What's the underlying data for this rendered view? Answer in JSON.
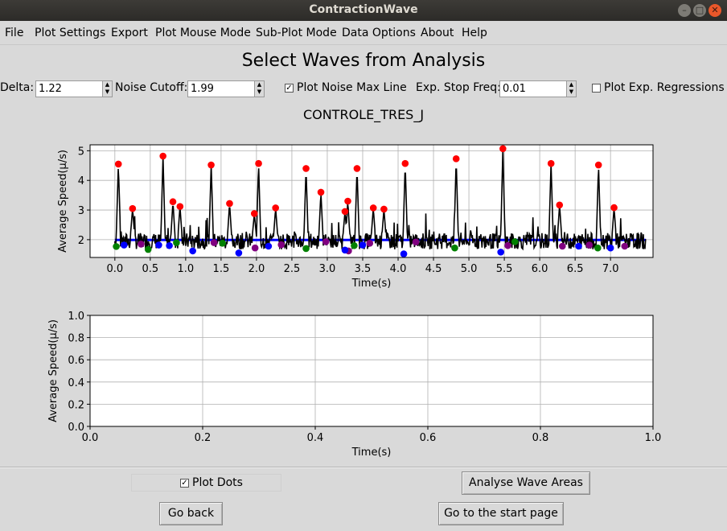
{
  "window": {
    "title": "ContractionWave"
  },
  "menu": [
    "File",
    "Plot Settings",
    "Export",
    "Plot Mouse Mode",
    "Sub-Plot Mode",
    "Data Options",
    "About",
    "Help"
  ],
  "heading": "Select Waves from Analysis",
  "controls": {
    "delta_label": "Delta:",
    "delta_value": "1.22",
    "noise_label": "Noise Cutoff:",
    "noise_value": "1.99",
    "plot_noise_label": "Plot Noise Max Line",
    "plot_noise_checked": true,
    "stop_label": "Exp. Stop Freq:",
    "stop_value": "0.01",
    "plot_exp_label": "Plot Exp. Regressions",
    "plot_exp_checked": false
  },
  "plot_title": "CONTROLE_TRES_J",
  "chart_data": [
    {
      "type": "line",
      "xlabel": "Time(s)",
      "ylabel": "Average Speed(μ/s)",
      "xlim": [
        -0.35,
        7.6
      ],
      "ylim": [
        1.4,
        5.2
      ],
      "xticks": [
        "0.0",
        "0.5",
        "1.0",
        "1.5",
        "2.0",
        "2.5",
        "3.0",
        "3.5",
        "4.0",
        "4.5",
        "5.0",
        "5.5",
        "6.0",
        "6.5",
        "7.0"
      ],
      "yticks": [
        "2",
        "3",
        "4",
        "5"
      ],
      "grid": true,
      "noise_line": 1.99,
      "colors": {
        "signal": "#000000",
        "noise_line": "#0000ff",
        "peak": "#ff0000",
        "blue": "#0000ff",
        "green": "#008000",
        "purple": "#800080"
      },
      "peaks": [
        [
          0.05,
          4.55
        ],
        [
          0.25,
          3.05
        ],
        [
          0.68,
          4.82
        ],
        [
          0.82,
          3.28
        ],
        [
          0.92,
          3.12
        ],
        [
          1.36,
          4.52
        ],
        [
          1.62,
          3.22
        ],
        [
          1.97,
          2.88
        ],
        [
          2.03,
          4.57
        ],
        [
          2.27,
          3.07
        ],
        [
          2.7,
          4.4
        ],
        [
          2.91,
          3.6
        ],
        [
          3.25,
          2.95
        ],
        [
          3.29,
          3.3
        ],
        [
          3.42,
          4.4
        ],
        [
          3.65,
          3.07
        ],
        [
          3.8,
          3.03
        ],
        [
          4.1,
          4.57
        ],
        [
          4.82,
          4.73
        ],
        [
          5.48,
          5.07
        ],
        [
          6.16,
          4.57
        ],
        [
          6.28,
          3.17
        ],
        [
          6.83,
          4.52
        ],
        [
          7.05,
          3.08
        ]
      ],
      "blue_points": [
        [
          0.13,
          1.82
        ],
        [
          0.62,
          1.82
        ],
        [
          0.77,
          1.8
        ],
        [
          1.1,
          1.62
        ],
        [
          1.75,
          1.55
        ],
        [
          2.17,
          1.78
        ],
        [
          3.25,
          1.65
        ],
        [
          3.5,
          1.82
        ],
        [
          4.08,
          1.52
        ],
        [
          5.45,
          1.58
        ],
        [
          6.55,
          1.78
        ],
        [
          7.0,
          1.72
        ]
      ],
      "green_points": [
        [
          0.02,
          1.77
        ],
        [
          0.47,
          1.67
        ],
        [
          0.87,
          1.9
        ],
        [
          1.52,
          1.88
        ],
        [
          2.7,
          1.7
        ],
        [
          3.38,
          1.8
        ],
        [
          4.8,
          1.72
        ],
        [
          5.65,
          1.93
        ],
        [
          6.82,
          1.72
        ]
      ],
      "purple_points": [
        [
          0.37,
          1.85
        ],
        [
          1.4,
          1.9
        ],
        [
          1.98,
          1.72
        ],
        [
          2.35,
          1.83
        ],
        [
          2.98,
          1.93
        ],
        [
          3.3,
          1.62
        ],
        [
          3.6,
          1.88
        ],
        [
          4.25,
          1.92
        ],
        [
          5.55,
          1.8
        ],
        [
          6.32,
          1.78
        ],
        [
          6.7,
          1.82
        ],
        [
          7.2,
          1.78
        ]
      ]
    },
    {
      "type": "line",
      "xlabel": "Time(s)",
      "ylabel": "Average Speed(μ/s)",
      "xlim": [
        0,
        1
      ],
      "ylim": [
        0,
        1
      ],
      "xticks": [
        "0.0",
        "0.2",
        "0.4",
        "0.6",
        "0.8",
        "1.0"
      ],
      "yticks": [
        "0.0",
        "0.2",
        "0.4",
        "0.6",
        "0.8",
        "1.0"
      ],
      "grid": true
    }
  ],
  "bottom": {
    "plot_dots_label": "Plot Dots",
    "plot_dots_checked": true,
    "analyse_label": "Analyse Wave Areas",
    "back_label": "Go back",
    "start_label": "Go to the start page"
  }
}
